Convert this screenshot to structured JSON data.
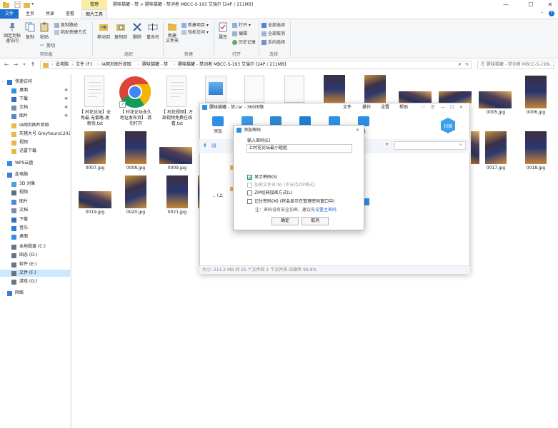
{
  "titlebar": {
    "manage_tab": "管理",
    "window_title": "腥味猫罐 - 禁 > 腥味猫罐 - 禁词者 MBCC-S-193 艾瑞尔 [24P / 211MB]",
    "minimize": "—",
    "maximize": "☐",
    "close": "✕"
  },
  "tabs": [
    "文件",
    "主页",
    "共享",
    "查看",
    "图片工具"
  ],
  "ribbon": {
    "pin_quick": "固定到快\n速访问",
    "copy": "复制",
    "paste": "粘贴",
    "copy_path": "复制路径",
    "paste_shortcut": "粘贴快捷方式",
    "cut": "剪切",
    "move_to": "移动到",
    "copy_to": "复制到",
    "delete": "删除",
    "rename": "重命名",
    "new_folder": "新建\n文件夹",
    "new_item": "新建项目 ▾",
    "easy_access": "轻松访问 ▾",
    "properties": "属性",
    "open": "打开 ▾",
    "edit": "编辑",
    "history": "历史记录",
    "select_all": "全部选择",
    "select_none": "全部取消",
    "invert": "反向选择",
    "group_clipboard": "剪贴板",
    "group_organize": "组织",
    "group_new": "新建",
    "group_open": "打开",
    "group_select": "选择"
  },
  "address": {
    "crumbs": [
      "此电脑",
      "文件 (F:)",
      "IA网页图片抓取",
      "腥味猫罐 - 禁",
      "腥味猫罐 - 禁词者 MBCC-S-193 艾瑞尔 [24P / 211MB]"
    ],
    "search_placeholder": "在 腥味猫罐 - 禁词者 MBCC-S-193 ..."
  },
  "nav": [
    {
      "label": "快速访问",
      "icon": "star-icon",
      "color": "#2b78d6",
      "indent": 0
    },
    {
      "label": "桌面",
      "icon": "desktop-icon",
      "color": "#3a8ee6",
      "indent": 1,
      "pinned": true
    },
    {
      "label": "下载",
      "icon": "download-icon",
      "color": "#2f6fc0",
      "indent": 1,
      "pinned": true
    },
    {
      "label": "文档",
      "icon": "document-icon",
      "color": "#7a8ca6",
      "indent": 1,
      "pinned": true
    },
    {
      "label": "图片",
      "icon": "picture-icon",
      "color": "#4f8ad1",
      "indent": 1,
      "pinned": true
    },
    {
      "label": "IA网页图片抓取",
      "icon": "folder-icon",
      "color": "#e8b84a",
      "indent": 1
    },
    {
      "label": "灰猪大号 Greyhound.202",
      "icon": "folder-icon",
      "color": "#e8b84a",
      "indent": 1
    },
    {
      "label": "视频",
      "icon": "folder-icon",
      "color": "#e8b84a",
      "indent": 1
    },
    {
      "label": "迅雷下载",
      "icon": "folder-icon",
      "color": "#e8b84a",
      "indent": 1
    },
    {
      "label": "WPS云盘",
      "icon": "cloud-icon",
      "color": "#2d8cf0",
      "indent": 0
    },
    {
      "label": "此电脑",
      "icon": "computer-icon",
      "color": "#3b7dd8",
      "indent": 0
    },
    {
      "label": "3D 对象",
      "icon": "cube-icon",
      "color": "#4aa3e0",
      "indent": 1
    },
    {
      "label": "视频",
      "icon": "video-icon",
      "color": "#5a6f8a",
      "indent": 1
    },
    {
      "label": "图片",
      "icon": "picture-icon",
      "color": "#4f8ad1",
      "indent": 1
    },
    {
      "label": "文档",
      "icon": "document-icon",
      "color": "#7a8ca6",
      "indent": 1
    },
    {
      "label": "下载",
      "icon": "download-icon",
      "color": "#2f6fc0",
      "indent": 1
    },
    {
      "label": "音乐",
      "icon": "music-icon",
      "color": "#2d7fd3",
      "indent": 1
    },
    {
      "label": "桌面",
      "icon": "desktop-icon",
      "color": "#3a8ee6",
      "indent": 1
    },
    {
      "label": "本地磁盘 (C:)",
      "icon": "drive-icon",
      "color": "#6a7480",
      "indent": 1
    },
    {
      "label": "固态 (D:)",
      "icon": "drive-icon",
      "color": "#6a7480",
      "indent": 1
    },
    {
      "label": "软件 (E:)",
      "icon": "drive-icon",
      "color": "#6a7480",
      "indent": 1
    },
    {
      "label": "文件 (F:)",
      "icon": "drive-icon",
      "color": "#6a7480",
      "indent": 1,
      "selected": true
    },
    {
      "label": "游戏 (G:)",
      "icon": "drive-icon",
      "color": "#6a7480",
      "indent": 1
    },
    {
      "label": "网络",
      "icon": "network-icon",
      "color": "#3b7dd8",
      "indent": 0
    }
  ],
  "files": {
    "txt1": "【 村花论坛】全\n免最-无套路-更\n新快.txt",
    "chrome1": "【 村花论坛永久\n地址发布页】-请\n勿打开",
    "txt2": "【 村花视频】万\n部视频免费在线\n看.txt",
    "f0005": "0005.jpg",
    "f0006": "0006.jpg",
    "f0007": "0007.jpg",
    "f0008": "0008.jpg",
    "f0009": "0009.jpg",
    "f0017": "0017.jpg",
    "f0018": "0018.jpg",
    "f0019": "0019.jpg",
    "f0020": "0020.jpg",
    "f0021": "0021.jpg"
  },
  "zip": {
    "title": "腥味猫罐 - 禁.rar - 360压缩",
    "menu": [
      "文件",
      "操作",
      "设置",
      "帮助"
    ],
    "add": "添加",
    "tool_last": "具",
    "scan": "扫描",
    "list_up": ".. (上",
    "status": "大小: 211.2 MB 共 25 个文件和 1 个文件夹 压缩率 99.9%"
  },
  "dialog": {
    "title": "添加密码",
    "close": "✕",
    "prompt": "输入密码(E)",
    "password_value": "上村花论坛最小姐姐",
    "show_password": "显示密码(S)",
    "encrypt_names": "加密文件名(N) (不支持ZIP格式)",
    "zip_classic": "ZIP经典加密方式(L)",
    "remember": "记住密码(M) (将会显示在管理密码窗口中)",
    "note_prefix": "注：密码设有安全加密，建议先",
    "note_link": "设置主密码",
    "ok": "确定",
    "cancel": "取消"
  },
  "colors": {
    "accent": "#1f6fd1",
    "manage_tab": "#fbeea4",
    "selection": "#cce8ff",
    "zip_blue": "#2c8ee6"
  }
}
